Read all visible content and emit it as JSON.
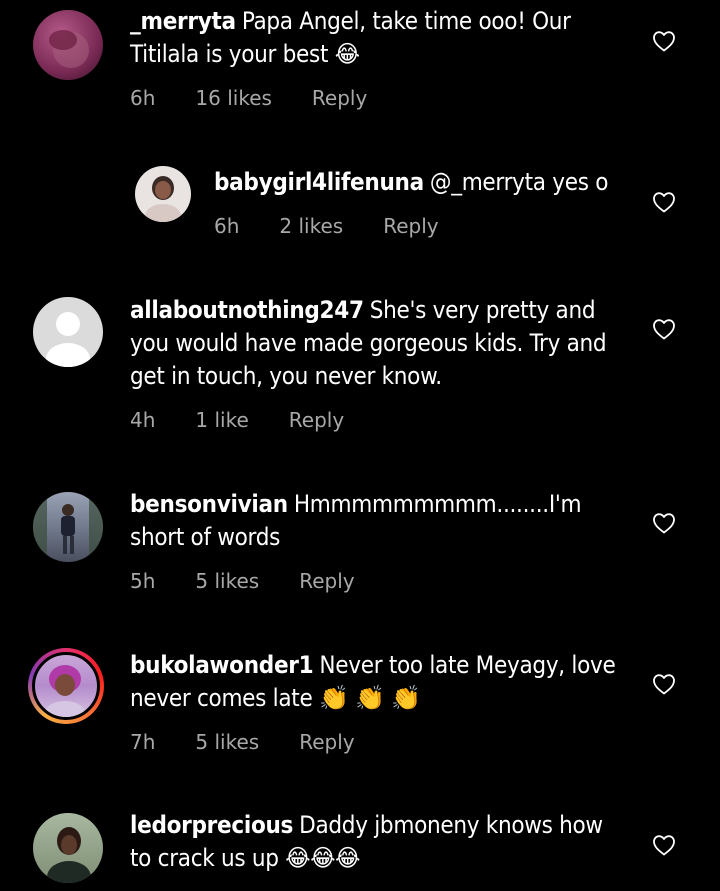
{
  "comments": [
    {
      "username": "_merryta",
      "text": "Papa Angel, take time ooo! Our Titilala is your best",
      "emoji": "😂",
      "time": "6h",
      "likes": "16 likes",
      "reply_label": "Reply"
    },
    {
      "username": "babygirl4lifenuna",
      "text": "@_merryta yes o",
      "emoji": "",
      "time": "6h",
      "likes": "2 likes",
      "reply_label": "Reply"
    },
    {
      "username": "allaboutnothing247",
      "text": "She's very pretty and you would have made gorgeous kids. Try and get in touch, you never know.",
      "emoji": "",
      "time": "4h",
      "likes": "1 like",
      "reply_label": "Reply"
    },
    {
      "username": "bensonvivian",
      "text": "Hmmmmmmmmm........I'm short of words",
      "emoji": "",
      "time": "5h",
      "likes": "5 likes",
      "reply_label": "Reply"
    },
    {
      "username": "bukolawonder1",
      "text": "Never too late Meyagy, love never comes late",
      "emoji": "👏 👏 👏",
      "time": "7h",
      "likes": "5 likes",
      "reply_label": "Reply"
    },
    {
      "username": "ledorprecious",
      "text": "Daddy jbmoneny knows how to crack us up",
      "emoji": "😂😂😂",
      "time": "",
      "likes": "",
      "reply_label": ""
    }
  ],
  "icons": {
    "like": "heart-outline-icon",
    "default_avatar": "person-silhouette-icon"
  },
  "colors": {
    "background": "#000000",
    "text": "#ffffff",
    "meta": "#a8a8a8"
  }
}
